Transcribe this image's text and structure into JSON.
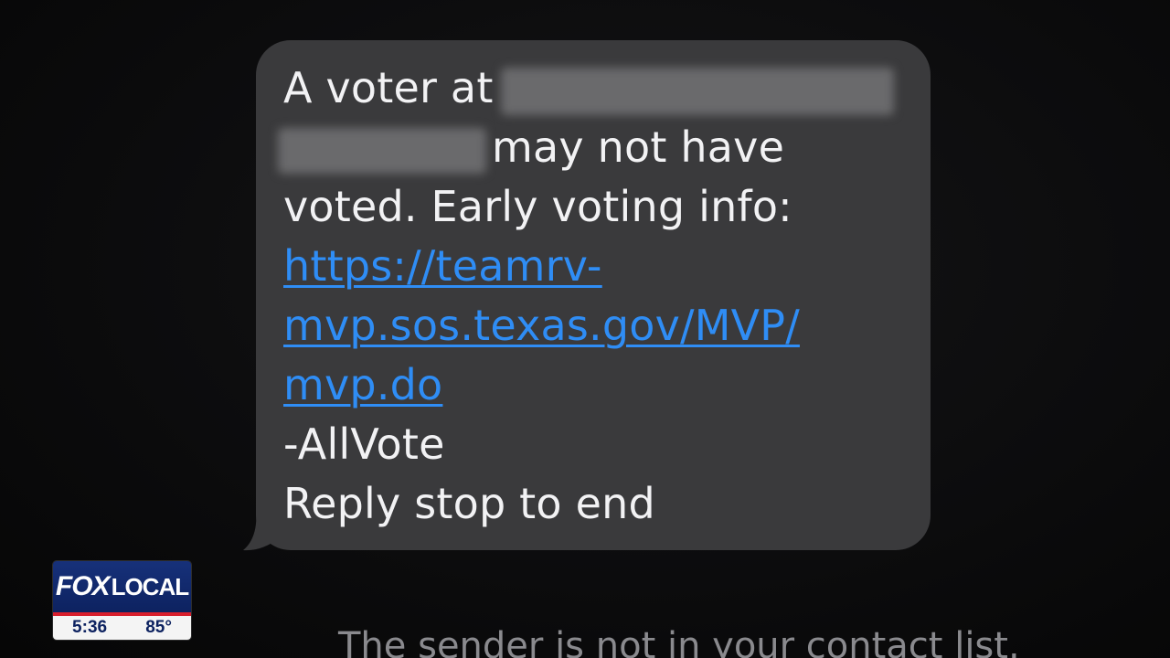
{
  "message": {
    "line1_prefix": "A voter at",
    "line2_suffix": "may not have",
    "line3": "voted. Early voting info:",
    "link_lines": [
      "https://teamrv-",
      "mvp.sos.texas.gov/MVP/",
      "mvp.do"
    ],
    "signature": "-AllVote",
    "opt_out": "Reply stop to end"
  },
  "footer": {
    "note": "The sender is not in your contact list."
  },
  "broadcast_bug": {
    "brand_fox": "FOX",
    "brand_local": "LOCAL",
    "time": "5:36",
    "temperature": "85°"
  },
  "colors": {
    "bubble": "#3a3a3c",
    "link": "#2f8df5",
    "bug_blue": "#0d2260",
    "bug_red": "#d81e2c"
  }
}
